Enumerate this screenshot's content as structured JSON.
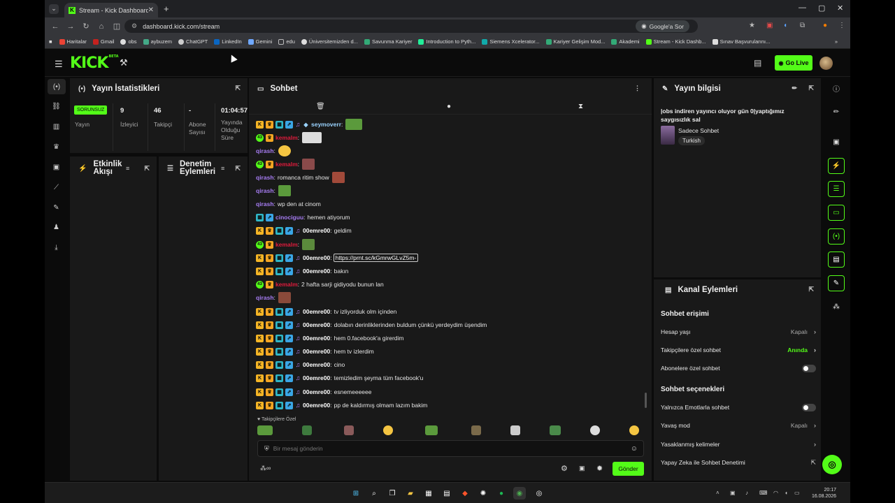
{
  "browser": {
    "tab_title": "Stream - Kick Dashboard",
    "url": "dashboard.kick.com/stream",
    "google_lens": "Google'a Sor",
    "bookmarks": [
      "Haritalar",
      "Gmail",
      "obs",
      "aybuzem",
      "ChatGPT",
      "LinkedIn",
      "Gemini",
      "edu",
      "Üniversitemizden d...",
      "Savunma Kariyer",
      "Introduction to Pyth...",
      "Siemens Xcelerator...",
      "Kariyer Gelişim Mod...",
      "Akademi",
      "Stream - Kick Dashb...",
      "Sınav Başvurularını..."
    ]
  },
  "header": {
    "logo": "KICK",
    "logo_sup": "BETA",
    "go_live": "Go Live"
  },
  "stats": {
    "title": "Yayın İstatistikleri",
    "status_badge": "SORUNSUZ",
    "items": [
      {
        "value": "",
        "label": "Yayın"
      },
      {
        "value": "9",
        "label": "İzleyici"
      },
      {
        "value": "46",
        "label": "Takipçi"
      },
      {
        "value": "-",
        "label": "Abone Sayısı"
      },
      {
        "value": "01:04:57",
        "label": "Yayında Olduğu Süre"
      }
    ]
  },
  "activity": {
    "title": "Etkinlik Akışı"
  },
  "moderation": {
    "title": "Denetim Eylemleri"
  },
  "chat": {
    "title": "Sohbet",
    "messages": [
      {
        "user": "seymoverr",
        "color": "#9ad3ff",
        "text": "",
        "badges": "kctbmd"
      },
      {
        "user": "kemalm",
        "color": "#e01b3c",
        "text": "",
        "badges": "nc"
      },
      {
        "user": "qirash",
        "color": "#a67cf2",
        "text": "",
        "badges": ""
      },
      {
        "user": "kemalm",
        "color": "#e01b3c",
        "text": "",
        "badges": "nc"
      },
      {
        "user": "qirash",
        "color": "#a67cf2",
        "text": "romanca ritim show",
        "badges": ""
      },
      {
        "user": "qirash",
        "color": "#a67cf2",
        "text": "",
        "badges": ""
      },
      {
        "user": "qirash",
        "color": "#a67cf2",
        "text": "wp den at cinom",
        "badges": ""
      },
      {
        "user": "cinociguu",
        "color": "#a67cf2",
        "text": "hemen atiyorum",
        "badges": "tb"
      },
      {
        "user": "00emre00",
        "color": "#ffffff",
        "text": "geldim",
        "badges": "kctbm"
      },
      {
        "user": "kemalm",
        "color": "#e01b3c",
        "text": "",
        "badges": "nc"
      },
      {
        "user": "00emre00",
        "color": "#ffffff",
        "text": "",
        "link": "https://prnt.sc/kGmrwGLvZ5m-",
        "badges": "kctbm"
      },
      {
        "user": "00emre00",
        "color": "#ffffff",
        "text": "bakın",
        "badges": "kctbm"
      },
      {
        "user": "kemalm",
        "color": "#e01b3c",
        "text": "2 hafta sarji gidiyodu bunun lan",
        "badges": "nc"
      },
      {
        "user": "qirash",
        "color": "#a67cf2",
        "text": "",
        "badges": ""
      },
      {
        "user": "00emre00",
        "color": "#ffffff",
        "text": "tv izliyorduk olm içinden",
        "badges": "kctbm"
      },
      {
        "user": "00emre00",
        "color": "#ffffff",
        "text": "dolabın derinliklerinden buldum çünkü yerdeydim üşendim",
        "badges": "kctbm"
      },
      {
        "user": "00emre00",
        "color": "#ffffff",
        "text": "hem 0.facebook'a girerdim",
        "badges": "kctbm"
      },
      {
        "user": "00emre00",
        "color": "#ffffff",
        "text": "hem tv izlerdim",
        "badges": "kctbm"
      },
      {
        "user": "00emre00",
        "color": "#ffffff",
        "text": "cino",
        "badges": "kctbm"
      },
      {
        "user": "00emre00",
        "color": "#ffffff",
        "text": "temizledim şeyma tüm facebook'u",
        "badges": "kctbm"
      },
      {
        "user": "00emre00",
        "color": "#ffffff",
        "text": "esnemeeeeee",
        "badges": "kctbm"
      },
      {
        "user": "00emre00",
        "color": "#ffffff",
        "text": "pp de kaldırmış olmam lazım bakim",
        "badges": "kctbm"
      }
    ],
    "followers_only": "Takipçilere Özel",
    "input_placeholder": "Bir mesaj gönderin",
    "send": "Gönder"
  },
  "info": {
    "title": "Yayın bilgisi",
    "stream_title": "|obs indiren yayıncı oluyor gün 0|yaptığımız saygısızlık sal",
    "category": "Sadece Sohbet",
    "language": "Turkish"
  },
  "actions": {
    "title": "Kanal Eylemleri",
    "access_section": "Sohbet erişimi",
    "account_age": {
      "label": "Hesap yaşı",
      "value": "Kapalı"
    },
    "followers_only": {
      "label": "Takipçilere özel sohbet",
      "value": "Anında"
    },
    "subs_only": {
      "label": "Abonelere özel sohbet"
    },
    "options_section": "Sohbet seçenekleri",
    "emotes_only": {
      "label": "Yalnızca Emotlarla sohbet"
    },
    "slow_mode": {
      "label": "Yavaş mod",
      "value": "Kapalı"
    },
    "banned_words": {
      "label": "Yasaklanmış kelimeler"
    },
    "ai_mod": {
      "label": "Yapay Zeka ile Sohbet Denetimi"
    }
  },
  "taskbar": {
    "time": "20:17",
    "date": "16.08.2026"
  }
}
